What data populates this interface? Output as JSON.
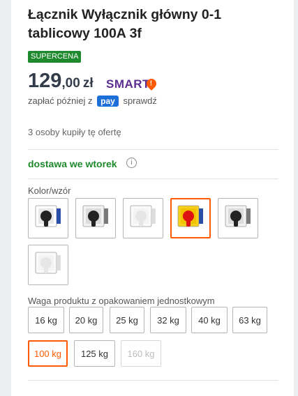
{
  "product": {
    "title": "Łącznik Wyłącznik główny 0-1 tablicowy 100A 3f",
    "badge": "SUPERCENA",
    "price_int": "129",
    "price_dec": ",00",
    "currency": "zł",
    "smart_label": "SMART",
    "pay_later_text": "zapłać później z",
    "pay_logo": "pay",
    "check_link": "sprawdź",
    "bought_text": "3 osoby kupiły tę ofertę",
    "delivery_text": "dostawa we wtorek",
    "info_icon_glyph": "i"
  },
  "colors": {
    "accent": "#ff5a00",
    "badge_green": "#1f8a2d",
    "smart_purple": "#5b2d8e",
    "pay_blue": "#1c6fd8"
  },
  "variants": {
    "label": "Kolor/wzór",
    "selected_index": 3,
    "items": [
      {
        "icon": "black-blue-switch-icon"
      },
      {
        "icon": "black-gray-switch-icon"
      },
      {
        "icon": "white-switch-icon"
      },
      {
        "icon": "red-yellow-switch-icon"
      },
      {
        "icon": "black-gray-switch-icon"
      },
      {
        "icon": "white-switch-icon"
      }
    ]
  },
  "weights": {
    "label": "Waga produktu z opakowaniem jednostkowym",
    "options": [
      {
        "label": "16 kg",
        "state": "normal"
      },
      {
        "label": "20 kg",
        "state": "normal"
      },
      {
        "label": "25 kg",
        "state": "normal"
      },
      {
        "label": "32 kg",
        "state": "normal"
      },
      {
        "label": "40 kg",
        "state": "normal"
      },
      {
        "label": "63 kg",
        "state": "normal"
      },
      {
        "label": "100 kg",
        "state": "selected"
      },
      {
        "label": "125 kg",
        "state": "normal"
      },
      {
        "label": "160 kg",
        "state": "disabled"
      }
    ]
  }
}
